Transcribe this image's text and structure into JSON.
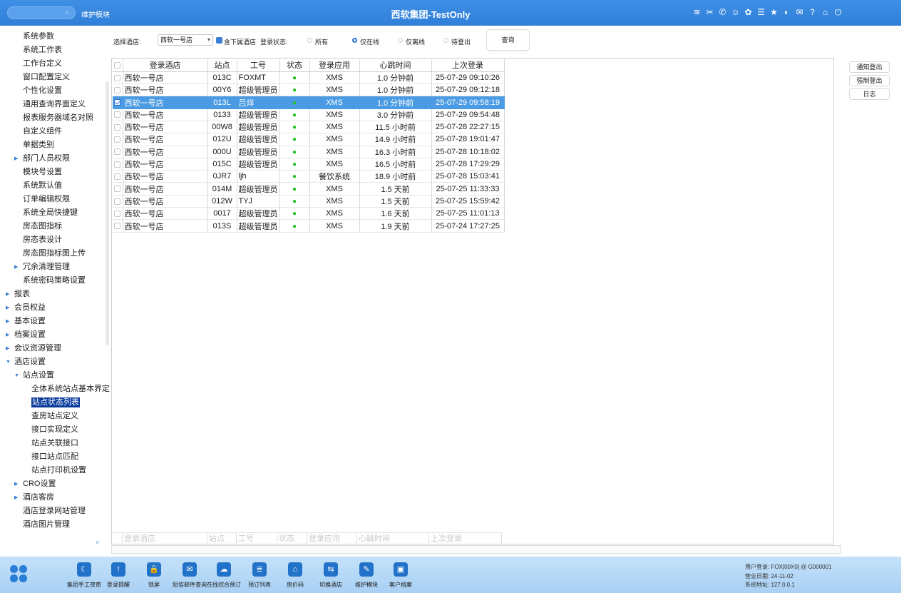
{
  "titlebar": {
    "module": "维护模块",
    "title": "西软集团-TestOnly",
    "icons": [
      "wifi-icon",
      "tools-icon",
      "phone-icon",
      "user-help-icon",
      "palette-icon",
      "menu-icon",
      "star-icon",
      "contrast-icon",
      "mail-icon",
      "help-icon",
      "home-icon",
      "power-icon"
    ]
  },
  "sidebar": {
    "items": [
      {
        "label": "系统参数",
        "level": 1
      },
      {
        "label": "系统工作表",
        "level": 1
      },
      {
        "label": "工作台定义",
        "level": 1
      },
      {
        "label": "窗口配置定义",
        "level": 1
      },
      {
        "label": "个性化设置",
        "level": 1
      },
      {
        "label": "通用查询界面定义",
        "level": 1
      },
      {
        "label": "报表服务器域名对照",
        "level": 1
      },
      {
        "label": "自定义组件",
        "level": 1
      },
      {
        "label": "单据类别",
        "level": 1
      },
      {
        "label": "部门人员权限",
        "level": 1,
        "arrow": "collapsed"
      },
      {
        "label": "模块号设置",
        "level": 1
      },
      {
        "label": "系统默认值",
        "level": 1
      },
      {
        "label": "订单编辑权限",
        "level": 1
      },
      {
        "label": "系统全局快捷键",
        "level": 1
      },
      {
        "label": "房态图指标",
        "level": 1
      },
      {
        "label": "房态表设计",
        "level": 1
      },
      {
        "label": "房态图指标图上传",
        "level": 1
      },
      {
        "label": "冗余清理管理",
        "level": 1,
        "arrow": "collapsed"
      },
      {
        "label": "系统密码策略设置",
        "level": 1
      },
      {
        "label": "报表",
        "level": 0,
        "arrow": "collapsed"
      },
      {
        "label": "会员权益",
        "level": 0,
        "arrow": "collapsed"
      },
      {
        "label": "基本设置",
        "level": 0,
        "arrow": "collapsed"
      },
      {
        "label": "档案设置",
        "level": 0,
        "arrow": "collapsed"
      },
      {
        "label": "会议资源管理",
        "level": 0,
        "arrow": "collapsed"
      },
      {
        "label": "酒店设置",
        "level": 0,
        "arrow": "expanded"
      },
      {
        "label": "站点设置",
        "level": 1,
        "arrow": "expanded"
      },
      {
        "label": "全体系统站点基本界定",
        "level": 2
      },
      {
        "label": "站点状态列表",
        "level": 2,
        "selected": true
      },
      {
        "label": "查房站点定义",
        "level": 2
      },
      {
        "label": "接口实现定义",
        "level": 2
      },
      {
        "label": "站点关联接口",
        "level": 2
      },
      {
        "label": "接口站点匹配",
        "level": 2
      },
      {
        "label": "站点打印机设置",
        "level": 2
      },
      {
        "label": "CRO设置",
        "level": 1,
        "arrow": "collapsed"
      },
      {
        "label": "酒店客房",
        "level": 1,
        "arrow": "collapsed"
      },
      {
        "label": "酒店登录网站管理",
        "level": 1
      },
      {
        "label": "酒店图片管理",
        "level": 1
      }
    ]
  },
  "filter": {
    "hotel_label": "选择酒店:",
    "hotel_value": "西软一号店",
    "include_sub_label": "含下属酒店",
    "status_label": "登录状态:",
    "options": [
      "所有",
      "仅在线",
      "仅离线",
      "待登出"
    ],
    "selected_option": "仅在线",
    "query_button": "查询"
  },
  "actions": {
    "notify_logout": "通知登出",
    "force_logout": "强制登出",
    "log": "日志"
  },
  "table": {
    "headers": [
      "登录酒店",
      "站点",
      "工号",
      "状态",
      "登录应用",
      "心跳时间",
      "上次登录"
    ],
    "rows": [
      {
        "hotel": "西软一号店",
        "station": "013C",
        "id": "FOXMT",
        "app": "XMS",
        "heartbeat": "1.0 分钟前",
        "last": "25-07-29 09:10:26",
        "checked": false,
        "selected": false
      },
      {
        "hotel": "西软一号店",
        "station": "00Y6",
        "id": "超级管理员",
        "app": "XMS",
        "heartbeat": "1.0 分钟前",
        "last": "25-07-29 09:12:18",
        "checked": false,
        "selected": false
      },
      {
        "hotel": "西软一号店",
        "station": "013L",
        "id": "吕烊",
        "app": "XMS",
        "heartbeat": "1.0 分钟前",
        "last": "25-07-29 09:58:19",
        "checked": true,
        "selected": true
      },
      {
        "hotel": "西软一号店",
        "station": "0133",
        "id": "超级管理员",
        "app": "XMS",
        "heartbeat": "3.0 分钟前",
        "last": "25-07-29 09:54:48",
        "checked": false,
        "selected": false
      },
      {
        "hotel": "西软一号店",
        "station": "00W8",
        "id": "超级管理员",
        "app": "XMS",
        "heartbeat": "11.5 小时前",
        "last": "25-07-28 22:27:15",
        "checked": false,
        "selected": false
      },
      {
        "hotel": "西软一号店",
        "station": "012U",
        "id": "超级管理员",
        "app": "XMS",
        "heartbeat": "14.9 小时前",
        "last": "25-07-28 19:01:47",
        "checked": false,
        "selected": false
      },
      {
        "hotel": "西软一号店",
        "station": "000U",
        "id": "超级管理员",
        "app": "XMS",
        "heartbeat": "16.3 小时前",
        "last": "25-07-28 10:18:02",
        "checked": false,
        "selected": false
      },
      {
        "hotel": "西软一号店",
        "station": "015C",
        "id": "超级管理员",
        "app": "XMS",
        "heartbeat": "16.5 小时前",
        "last": "25-07-28 17:29:29",
        "checked": false,
        "selected": false
      },
      {
        "hotel": "西软一号店",
        "station": "0JR7",
        "id": "ljh",
        "app": "餐饮系统",
        "heartbeat": "18.9 小时前",
        "last": "25-07-28 15:03:41",
        "checked": false,
        "selected": false
      },
      {
        "hotel": "西软一号店",
        "station": "014M",
        "id": "超级管理员",
        "app": "XMS",
        "heartbeat": "1.5 天前",
        "last": "25-07-25 11:33:33",
        "checked": false,
        "selected": false
      },
      {
        "hotel": "西软一号店",
        "station": "012W",
        "id": "TYJ",
        "app": "XMS",
        "heartbeat": "1.5 天前",
        "last": "25-07-25 15:59:42",
        "checked": false,
        "selected": false
      },
      {
        "hotel": "西软一号店",
        "station": "0017",
        "id": "超级管理员",
        "app": "XMS",
        "heartbeat": "1.6 天前",
        "last": "25-07-25 11:01:13",
        "checked": false,
        "selected": false
      },
      {
        "hotel": "西软一号店",
        "station": "013S",
        "id": "超级管理员",
        "app": "XMS",
        "heartbeat": "1.9 天前",
        "last": "25-07-24 17:27:25",
        "checked": false,
        "selected": false
      }
    ],
    "status_symbol": "●",
    "filter_placeholders": [
      "登录酒店",
      "站点",
      "工号",
      "状态",
      "登录应用",
      "心跳时间",
      "上次登录"
    ]
  },
  "dock": {
    "items": [
      {
        "label": "集团手工夜审",
        "icon": "moon-icon",
        "glyph": "☾"
      },
      {
        "label": "登录提醒",
        "icon": "alert-icon",
        "glyph": "!"
      },
      {
        "label": "锁屏",
        "icon": "lock-icon",
        "glyph": "🔒"
      },
      {
        "label": "短信邮件查询",
        "icon": "mail-icon",
        "glyph": "✉"
      },
      {
        "label": "在线综合预订",
        "icon": "cloud-icon",
        "glyph": "☁"
      },
      {
        "label": "预订列表",
        "icon": "list-icon",
        "glyph": "≣"
      },
      {
        "label": "房价码",
        "icon": "house-icon",
        "glyph": "⌂"
      },
      {
        "label": "切换酒店",
        "icon": "switch-icon",
        "glyph": "⇆"
      },
      {
        "label": "维护模块",
        "icon": "wrench-icon",
        "glyph": "✎"
      },
      {
        "label": "客户档案",
        "icon": "profile-icon",
        "glyph": "▣"
      }
    ],
    "info": {
      "user": "用户登录: FOX[00X0] @ G000001",
      "date": "营业日期: 24-11-02",
      "address": "系统地址: 127.0.0.1"
    }
  },
  "colors": {
    "titlebar": "#2f7fd8",
    "selected_row": "#4a9be3",
    "tree_selected": "#0a3b9c",
    "status_online": "#22c022"
  }
}
